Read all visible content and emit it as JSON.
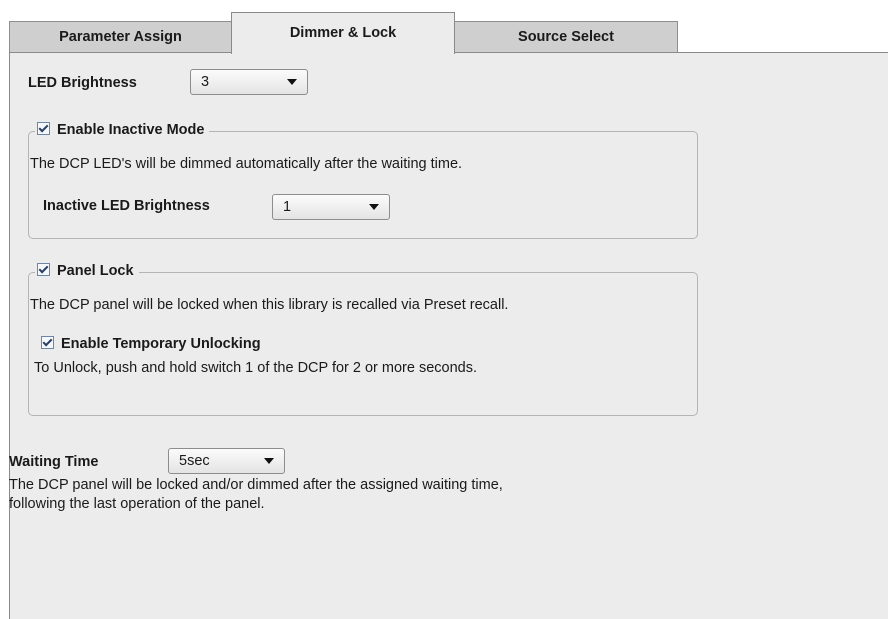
{
  "tabs": [
    {
      "label": "Parameter Assign",
      "active": false
    },
    {
      "label": "Dimmer & Lock",
      "active": true
    },
    {
      "label": "Source Select",
      "active": false
    }
  ],
  "led_brightness": {
    "label": "LED Brightness",
    "value": "3"
  },
  "inactive_mode": {
    "checkbox_label": "Enable Inactive Mode",
    "checked": true,
    "description": "The DCP LED's will be dimmed automatically after the waiting time.",
    "brightness_label": "Inactive LED Brightness",
    "brightness_value": "1"
  },
  "panel_lock": {
    "checkbox_label": "Panel Lock",
    "checked": true,
    "description": "The DCP panel will be locked when this library is recalled via Preset recall.",
    "temp_unlock_label": "Enable Temporary Unlocking",
    "temp_unlock_checked": true,
    "temp_unlock_description": "To Unlock, push and hold switch 1 of the DCP for 2 or more seconds."
  },
  "waiting_time": {
    "label": "Waiting Time",
    "value": "5sec",
    "description_line1": "The DCP panel will be locked and/or dimmed after the assigned waiting time,",
    "description_line2": "following the last operation of the panel."
  },
  "colors": {
    "panel_bg": "#ececec",
    "tab_bg": "#cfcfcf",
    "checkbox_check": "#2a3f63"
  }
}
